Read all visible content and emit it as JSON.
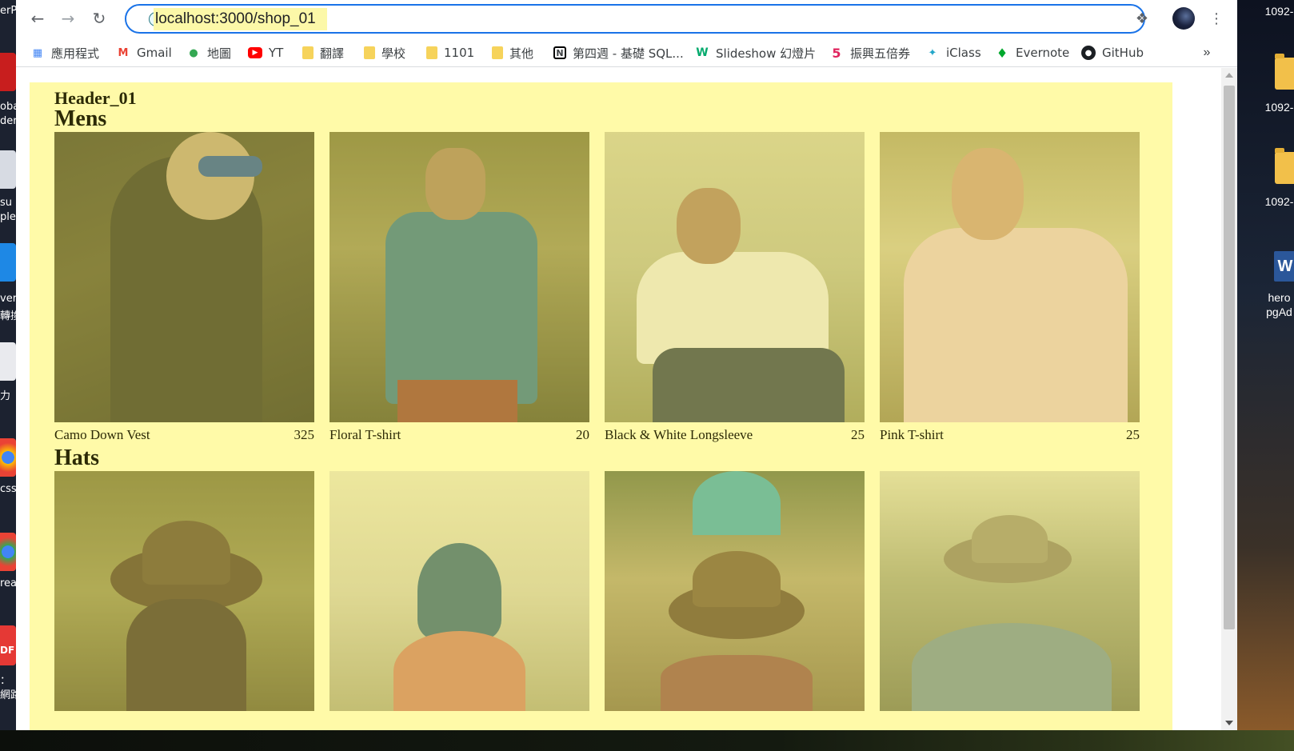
{
  "browser": {
    "url": "localhost:3000/shop_01",
    "nav": {
      "back_icon": "arrow-left-icon",
      "forward_icon": "arrow-right-icon",
      "reload_icon": "reload-icon"
    },
    "bookmarks": [
      {
        "label": "應用程式",
        "icon": "apps-grid-icon"
      },
      {
        "label": "Gmail",
        "icon": "gmail-icon"
      },
      {
        "label": "地圖",
        "icon": "maps-pin-icon"
      },
      {
        "label": "YT",
        "icon": "youtube-icon"
      },
      {
        "label": "翻譯",
        "icon": "folder-icon"
      },
      {
        "label": "學校",
        "icon": "folder-icon"
      },
      {
        "label": "1101",
        "icon": "folder-icon"
      },
      {
        "label": "其他",
        "icon": "folder-icon"
      },
      {
        "label": "第四週 - 基礎 SQL...",
        "icon": "notion-icon"
      },
      {
        "label": "Slideshow 幻燈片",
        "icon": "w3schools-icon"
      },
      {
        "label": "振興五倍券",
        "icon": "five-icon"
      },
      {
        "label": "iClass",
        "icon": "iclass-icon"
      },
      {
        "label": "Evernote",
        "icon": "evernote-icon"
      },
      {
        "label": "GitHub",
        "icon": "github-icon"
      }
    ],
    "more_label": "»"
  },
  "page": {
    "header": "Header_01",
    "sections": [
      {
        "title": "Mens",
        "items": [
          {
            "name": "Camo Down Vest",
            "price": "325"
          },
          {
            "name": "Floral T-shirt",
            "price": "20"
          },
          {
            "name": "Black & White Longsleeve",
            "price": "25"
          },
          {
            "name": "Pink T-shirt",
            "price": "25"
          }
        ]
      },
      {
        "title": "Hats",
        "items": [
          {
            "name": "",
            "price": ""
          },
          {
            "name": "",
            "price": ""
          },
          {
            "name": "",
            "price": ""
          },
          {
            "name": "",
            "price": ""
          }
        ]
      }
    ]
  },
  "desktop": {
    "right_labels": [
      "1092-",
      "1092-",
      "hero",
      "pgAd"
    ],
    "left_labels": [
      "erP",
      "oba",
      "der",
      "su",
      "ple",
      "ver",
      "轉換",
      "力",
      "css",
      "rea",
      "DF",
      "：",
      "網路"
    ]
  },
  "colors": {
    "page_bg": "#fffaa8",
    "focus_ring": "#1a73e8",
    "url_highlight": "#fcf8a8"
  }
}
